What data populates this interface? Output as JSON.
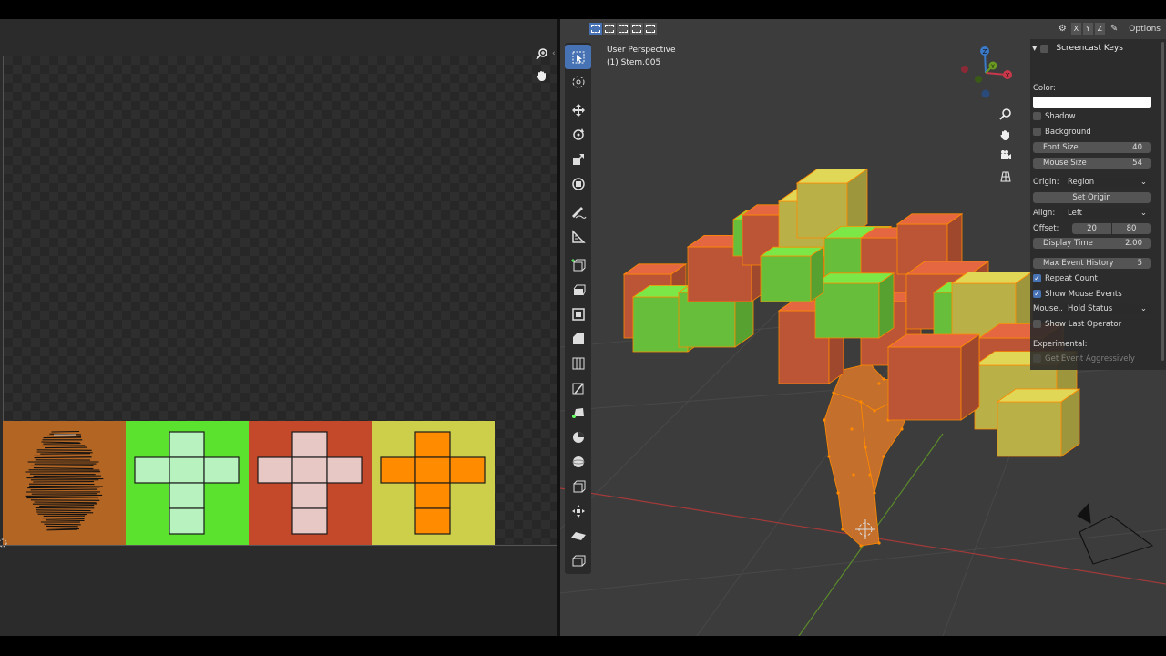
{
  "uv_editor": {
    "tile_colors": [
      "#b36523",
      "#5be22f",
      "#c3492a",
      "#cdcf4b"
    ],
    "cross_fill_colors": [
      "#b8f2bf",
      "#e8c8c4",
      "#ff8c00"
    ],
    "cross_stroke": "#1a1a1a"
  },
  "viewport": {
    "view_name": "User Perspective",
    "object_name": "(1) Stem.005",
    "header": {
      "axis_x": "X",
      "axis_y": "Y",
      "axis_z": "Z",
      "options_label": "Options"
    },
    "gizmo": {
      "x_label": "X",
      "y_label": "Y",
      "z_label": "Z"
    },
    "leaf_colors": {
      "green": "#6fcf3f",
      "red": "#cc5c3a",
      "yellow": "#c9c04d"
    },
    "stem_color": "#c46f2c",
    "grid_colors": {
      "x_axis": "#a33a3a",
      "y_axis": "#5a8a2a"
    }
  },
  "toolbar_icons": [
    "select-box-icon",
    "cursor-icon",
    "move-icon",
    "rotate-icon",
    "scale-icon",
    "transform-icon",
    "annotate-icon",
    "measure-icon",
    "add-cube-icon",
    "extrude-icon",
    "inset-icon",
    "bevel-icon",
    "loop-cut-icon",
    "knife-icon",
    "poly-build-icon",
    "spin-icon",
    "smooth-icon",
    "edge-slide-icon",
    "shrink-fatten-icon",
    "shear-icon",
    "rip-icon"
  ],
  "screencast_panel": {
    "title": "Screencast Keys",
    "color_label": "Color:",
    "color_value": "#ffffff",
    "shadow_label": "Shadow",
    "background_label": "Background",
    "font_size_label": "Font Size",
    "font_size_value": "40",
    "mouse_size_label": "Mouse Size",
    "mouse_size_value": "54",
    "origin_label": "Origin:",
    "origin_value": "Region",
    "set_origin_label": "Set Origin",
    "align_label": "Align:",
    "align_value": "Left",
    "offset_label": "Offset:",
    "offset_x": "20",
    "offset_y": "80",
    "display_time_label": "Display Time",
    "display_time_value": "2.00",
    "max_history_label": "Max Event History",
    "max_history_value": "5",
    "repeat_count_label": "Repeat Count",
    "repeat_count_checked": true,
    "show_mouse_events_label": "Show Mouse Events",
    "show_mouse_events_checked": true,
    "mouse_label": "Mouse...",
    "mouse_value": "Hold Status",
    "show_last_operator_label": "Show Last Operator",
    "show_last_operator_checked": false,
    "experimental_label": "Experimental:",
    "get_event_label": "Get Event Aggressively"
  }
}
